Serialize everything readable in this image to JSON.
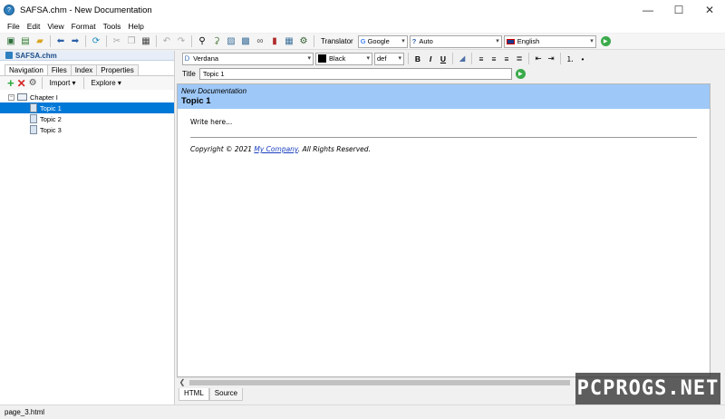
{
  "window": {
    "title": "SAFSA.chm - New Documentation",
    "minimize_glyph": "—",
    "maximize_glyph": "☐",
    "close_glyph": "✕"
  },
  "menu": [
    "File",
    "Edit",
    "View",
    "Format",
    "Tools",
    "Help"
  ],
  "toolbar": {
    "translator_label": "Translator",
    "engine": "Google",
    "source_lang": "Auto",
    "target_lang": "English"
  },
  "left_panel": {
    "project_name": "SAFSA.chm",
    "tabs": [
      "Navigation",
      "Files",
      "Index",
      "Properties"
    ],
    "import_label": "Import",
    "explore_label": "Explore",
    "tree": {
      "chapter": "Chapter I",
      "topics": [
        "Topic 1",
        "Topic 2",
        "Topic 3"
      ],
      "selected_index": 0
    }
  },
  "editor": {
    "font": "Verdana",
    "color_name": "Black",
    "size": "def",
    "title_label": "Title",
    "title_value": "Topic 1",
    "doc_project": "New Documentation",
    "doc_topic": "Topic 1",
    "doc_placeholder": "Write here...",
    "copyright_prefix": "Copyright © 2021 ",
    "copyright_link": "My Company",
    "copyright_suffix": ". All Rights Reserved.",
    "bottom_tabs": [
      "HTML",
      "Source"
    ]
  },
  "status": {
    "file": "page_3.html"
  },
  "watermark": "PCPROGS.NET",
  "colors": {
    "selection": "#0078d7",
    "doc_header": "#9ec8f7",
    "link": "#1a3fbf"
  }
}
